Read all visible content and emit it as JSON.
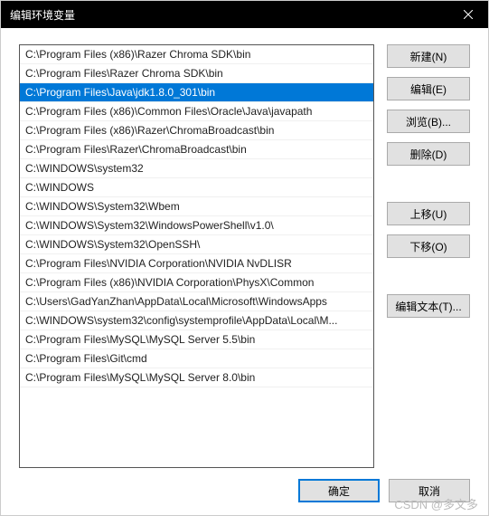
{
  "window": {
    "title": "编辑环境变量"
  },
  "list": {
    "items": [
      "C:\\Program Files (x86)\\Razer Chroma SDK\\bin",
      "C:\\Program Files\\Razer Chroma SDK\\bin",
      "C:\\Program Files\\Java\\jdk1.8.0_301\\bin",
      "C:\\Program Files (x86)\\Common Files\\Oracle\\Java\\javapath",
      "C:\\Program Files (x86)\\Razer\\ChromaBroadcast\\bin",
      "C:\\Program Files\\Razer\\ChromaBroadcast\\bin",
      "C:\\WINDOWS\\system32",
      "C:\\WINDOWS",
      "C:\\WINDOWS\\System32\\Wbem",
      "C:\\WINDOWS\\System32\\WindowsPowerShell\\v1.0\\",
      "C:\\WINDOWS\\System32\\OpenSSH\\",
      "C:\\Program Files\\NVIDIA Corporation\\NVIDIA NvDLISR",
      "C:\\Program Files (x86)\\NVIDIA Corporation\\PhysX\\Common",
      "C:\\Users\\GadYanZhan\\AppData\\Local\\Microsoft\\WindowsApps",
      "C:\\WINDOWS\\system32\\config\\systemprofile\\AppData\\Local\\M...",
      "C:\\Program Files\\MySQL\\MySQL Server 5.5\\bin",
      "C:\\Program Files\\Git\\cmd",
      "C:\\Program Files\\MySQL\\MySQL Server 8.0\\bin"
    ],
    "selected_index": 2
  },
  "buttons": {
    "new": "新建(N)",
    "edit": "编辑(E)",
    "browse": "浏览(B)...",
    "delete": "删除(D)",
    "move_up": "上移(U)",
    "move_down": "下移(O)",
    "edit_text": "编辑文本(T)...",
    "ok": "确定",
    "cancel": "取消"
  },
  "watermark": "CSDN @多文多"
}
